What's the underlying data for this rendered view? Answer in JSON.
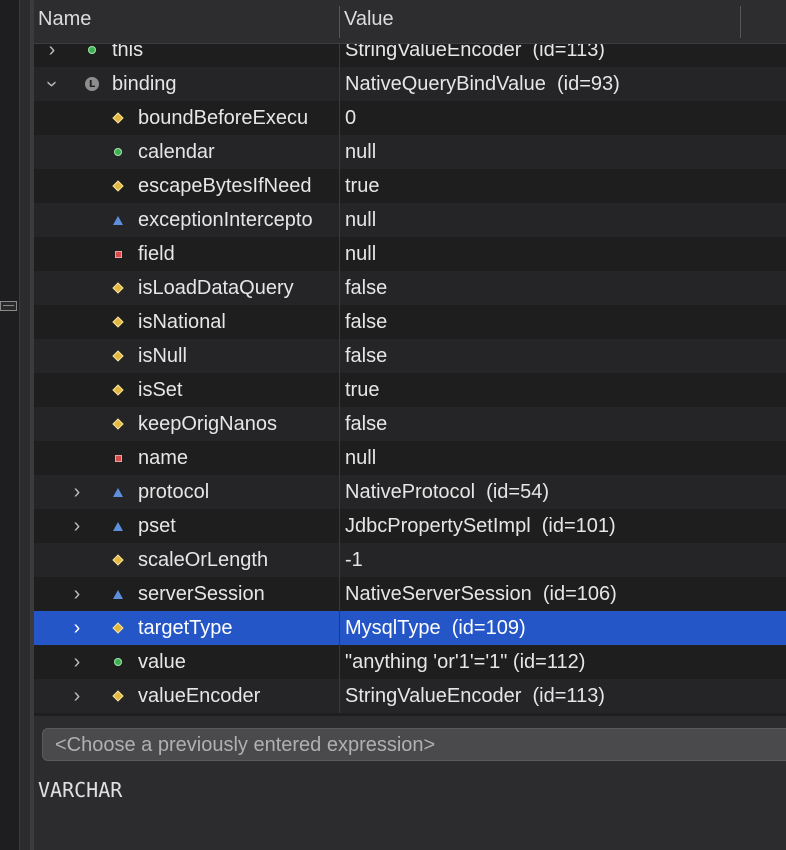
{
  "header": {
    "name_label": "Name",
    "value_label": "Value"
  },
  "rows": [
    {
      "name": "this",
      "value": "StringValueEncoder  (id=113)",
      "icon": "circle-icon",
      "expandable": true,
      "expanded": false,
      "depth": 0
    },
    {
      "name": "binding",
      "value": "NativeQueryBindValue  (id=93)",
      "icon": "local-variable-icon",
      "expandable": true,
      "expanded": true,
      "depth": 0
    },
    {
      "name": "boundBeforeExecu",
      "value": "0",
      "icon": "diamond-icon",
      "expandable": false,
      "depth": 1
    },
    {
      "name": "calendar",
      "value": "null",
      "icon": "circle-icon",
      "expandable": false,
      "depth": 1
    },
    {
      "name": "escapeBytesIfNeed",
      "value": "true",
      "icon": "diamond-icon",
      "expandable": false,
      "depth": 1
    },
    {
      "name": "exceptionIntercepto",
      "value": "null",
      "icon": "triangle-icon",
      "expandable": false,
      "depth": 1
    },
    {
      "name": "field",
      "value": "null",
      "icon": "square-icon",
      "expandable": false,
      "depth": 1
    },
    {
      "name": "isLoadDataQuery",
      "value": "false",
      "icon": "diamond-icon",
      "expandable": false,
      "depth": 1
    },
    {
      "name": "isNational",
      "value": "false",
      "icon": "diamond-icon",
      "expandable": false,
      "depth": 1
    },
    {
      "name": "isNull",
      "value": "false",
      "icon": "diamond-icon",
      "expandable": false,
      "depth": 1
    },
    {
      "name": "isSet",
      "value": "true",
      "icon": "diamond-icon",
      "expandable": false,
      "depth": 1
    },
    {
      "name": "keepOrigNanos",
      "value": "false",
      "icon": "diamond-icon",
      "expandable": false,
      "depth": 1
    },
    {
      "name": "name",
      "value": "null",
      "icon": "square-icon",
      "expandable": false,
      "depth": 1
    },
    {
      "name": "protocol",
      "value": "NativeProtocol  (id=54)",
      "icon": "triangle-icon",
      "expandable": true,
      "expanded": false,
      "depth": 1
    },
    {
      "name": "pset",
      "value": "JdbcPropertySetImpl  (id=101)",
      "icon": "triangle-icon",
      "expandable": true,
      "expanded": false,
      "depth": 1
    },
    {
      "name": "scaleOrLength",
      "value": "-1",
      "icon": "diamond-icon",
      "expandable": false,
      "depth": 1
    },
    {
      "name": "serverSession",
      "value": "NativeServerSession  (id=106)",
      "icon": "triangle-icon",
      "expandable": true,
      "expanded": false,
      "depth": 1
    },
    {
      "name": "targetType",
      "value": "MysqlType  (id=109)",
      "icon": "diamond-icon",
      "expandable": true,
      "expanded": false,
      "depth": 1,
      "selected": true
    },
    {
      "name": "value",
      "value": "\"anything 'or'1'='1\" (id=112)",
      "icon": "circle-icon",
      "expandable": true,
      "expanded": false,
      "depth": 1
    },
    {
      "name": "valueEncoder",
      "value": "StringValueEncoder  (id=113)",
      "icon": "diamond-icon",
      "expandable": true,
      "expanded": false,
      "depth": 1
    }
  ],
  "expression": {
    "placeholder": "<Choose a previously entered expression>"
  },
  "result": {
    "text": "VARCHAR"
  },
  "colors": {
    "selection": "#2456c8",
    "background": "#1e1e1e"
  }
}
